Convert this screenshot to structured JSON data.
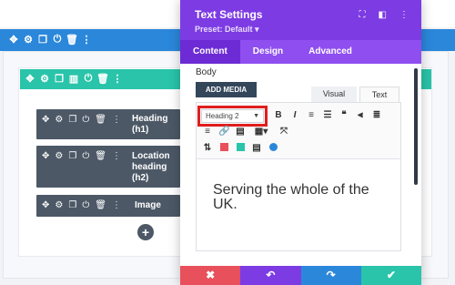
{
  "panel": {
    "title": "Text Settings",
    "preset": "Preset: Default ▾",
    "tabs": [
      "Content",
      "Design",
      "Advanced"
    ],
    "body_label": "Body",
    "add_media_label": "ADD MEDIA",
    "editor_tabs": [
      "Visual",
      "Text"
    ],
    "heading_select_value": "Heading 2",
    "content_text_line1": "Serving the whole of the",
    "content_text_line2": "UK.",
    "bottom_actions": {
      "cancel": "✖",
      "undo": "↶",
      "redo": "↷",
      "save": "✔"
    }
  },
  "modules": [
    {
      "label_line1": "Heading",
      "label_line2": "(h1)"
    },
    {
      "label_line1": "Location",
      "label_line2": "heading",
      "label_line3": "(h2)"
    },
    {
      "label_line1": "Image"
    }
  ],
  "colors": {
    "section": "#2b87da",
    "row": "#29c4a9",
    "panel_header": "#7d3be3",
    "tab_bar": "#8e4ef0",
    "cancel": "#e8505b",
    "undo": "#7d3be3",
    "redo": "#2b87da",
    "save": "#29c4a9",
    "highlight": "#e01e1e"
  }
}
